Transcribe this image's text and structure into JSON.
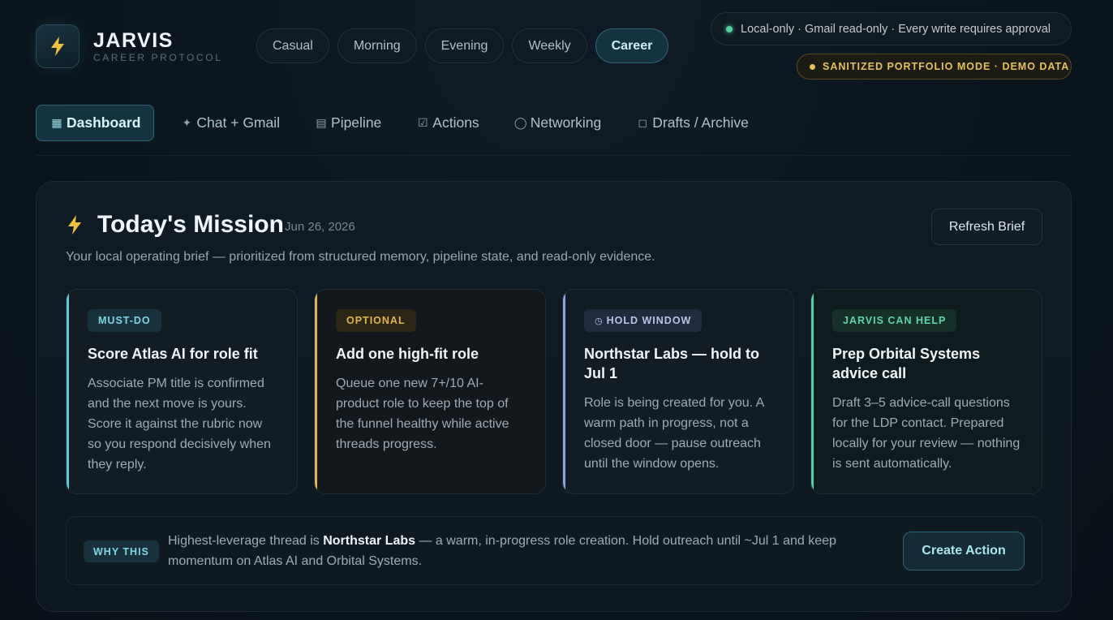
{
  "brand": {
    "title": "JARVIS",
    "subtitle": "CAREER PROTOCOL",
    "icon": "lightning-bolt-icon"
  },
  "modes": [
    {
      "label": "Casual",
      "active": false
    },
    {
      "label": "Morning",
      "active": false
    },
    {
      "label": "Evening",
      "active": false
    },
    {
      "label": "Weekly",
      "active": false
    },
    {
      "label": "Career",
      "active": true
    }
  ],
  "status": {
    "text": "Local-only · Gmail read-only · Every write requires approval",
    "color": "#4fd29d"
  },
  "demo_banner": {
    "text": "SANITIZED PORTFOLIO MODE · DEMO DATA",
    "color": "#e7c259"
  },
  "nav": [
    {
      "icon": "▦",
      "label": "Dashboard",
      "active": true
    },
    {
      "icon": "✦",
      "label": "Chat + Gmail",
      "active": false
    },
    {
      "icon": "▤",
      "label": "Pipeline",
      "active": false
    },
    {
      "icon": "☑",
      "label": "Actions",
      "active": false
    },
    {
      "icon": "◯",
      "label": "Networking",
      "active": false
    },
    {
      "icon": "◻",
      "label": "Drafts / Archive",
      "active": false
    }
  ],
  "mission": {
    "title": "Today's Mission",
    "date": "Jun 26, 2026",
    "subtitle": "Your local operating brief — prioritized from structured memory, pipeline state, and read-only evidence.",
    "refresh_label": "Refresh Brief"
  },
  "cards": [
    {
      "badge": "MUST-DO",
      "badge_icon": "",
      "title": "Score Atlas AI for role fit",
      "body": "Associate PM title is confirmed and the next move is yours. Score it against the rubric now so you respond decisively when they reply.",
      "accent": "#5fc8dd"
    },
    {
      "badge": "OPTIONAL",
      "badge_icon": "",
      "title": "Add one high-fit role",
      "body": "Queue one new 7+/10 AI-product role to keep the top of the funnel healthy while active threads progress.",
      "accent": "#e3b54f"
    },
    {
      "badge": "HOLD WINDOW",
      "badge_icon": "◷",
      "title": "Northstar Labs — hold to Jul 1",
      "body": "Role is being created for you. A warm path in progress, not a closed door — pause outreach until the window opens.",
      "accent": "#8da3e6"
    },
    {
      "badge": "JARVIS CAN HELP",
      "badge_icon": "",
      "title": "Prep Orbital Systems advice call",
      "body": "Draft 3–5 advice-call questions for the LDP contact. Prepared locally for your review — nothing is sent automatically.",
      "accent": "#4fd29d"
    }
  ],
  "why": {
    "badge": "WHY THIS",
    "prefix": "Highest-leverage thread is ",
    "highlight": "Northstar Labs",
    "suffix": " — a warm, in-progress role creation. Hold outreach until ~Jul 1 and keep momentum on Atlas AI and Orbital Systems.",
    "button_label": "Create Action"
  }
}
